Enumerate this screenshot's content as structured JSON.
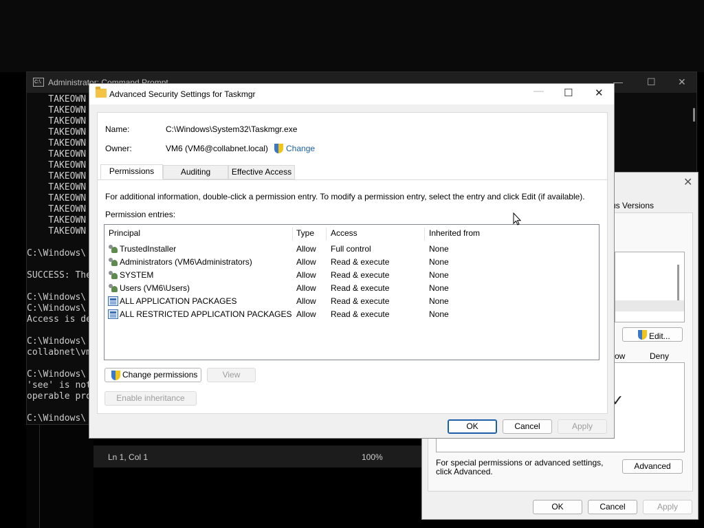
{
  "cmd": {
    "title": "Administrator: Command Prompt",
    "icon_text": "C:\\.",
    "lines": [
      "    TAKEOWN",
      "    TAKEOWN",
      "    TAKEOWN",
      "    TAKEOWN",
      "    TAKEOWN",
      "    TAKEOWN",
      "    TAKEOWN",
      "    TAKEOWN",
      "    TAKEOWN",
      "    TAKEOWN",
      "    TAKEOWN",
      "    TAKEOWN",
      "    TAKEOWN",
      "",
      "C:\\Windows\\",
      "",
      "SUCCESS: The",
      "",
      "C:\\Windows\\",
      "C:\\Windows\\",
      "Access is de",
      "",
      "C:\\Windows\\",
      "collabnet\\vm",
      "",
      "C:\\Windows\\",
      "'see' is not",
      "operable pro",
      "",
      "C:\\Windows\\"
    ]
  },
  "notepad_status": {
    "position": "Ln 1, Col 1",
    "zoom": "100%"
  },
  "properties": {
    "tab_partial": "us Versions",
    "edit_label": "Edit...",
    "allow_header": "ow",
    "deny_header": "Deny",
    "check_mark": "✓",
    "special_text": "For special permissions or advanced settings, click Advanced.",
    "advanced_label": "Advanced",
    "ok_label": "OK",
    "cancel_label": "Cancel",
    "apply_label": "Apply"
  },
  "dialog": {
    "title": "Advanced Security Settings for Taskmgr",
    "name_label": "Name:",
    "name_value": "C:\\Windows\\System32\\Taskmgr.exe",
    "owner_label": "Owner:",
    "owner_value": "VM6 (VM6@collabnet.local)",
    "change_link": "Change",
    "tabs": [
      "Permissions",
      "Auditing",
      "Effective Access"
    ],
    "info_text": "For additional information, double-click a permission entry. To modify a permission entry, select the entry and click Edit (if available).",
    "entries_label": "Permission entries:",
    "columns": [
      "Principal",
      "Type",
      "Access",
      "Inherited from"
    ],
    "rows": [
      {
        "principal": "TrustedInstaller",
        "type": "Allow",
        "access": "Full control",
        "inherited": "None",
        "icon": "users"
      },
      {
        "principal": "Administrators (VM6\\Administrators)",
        "type": "Allow",
        "access": "Read & execute",
        "inherited": "None",
        "icon": "users"
      },
      {
        "principal": "SYSTEM",
        "type": "Allow",
        "access": "Read & execute",
        "inherited": "None",
        "icon": "users"
      },
      {
        "principal": "Users (VM6\\Users)",
        "type": "Allow",
        "access": "Read & execute",
        "inherited": "None",
        "icon": "users"
      },
      {
        "principal": "ALL APPLICATION PACKAGES",
        "type": "Allow",
        "access": "Read & execute",
        "inherited": "None",
        "icon": "pkg"
      },
      {
        "principal": "ALL RESTRICTED APPLICATION PACKAGES",
        "type": "Allow",
        "access": "Read & execute",
        "inherited": "None",
        "icon": "pkg"
      }
    ],
    "change_permissions_label": "Change permissions",
    "view_label": "View",
    "enable_inheritance_label": "Enable inheritance",
    "ok_label": "OK",
    "cancel_label": "Cancel",
    "apply_label": "Apply"
  }
}
